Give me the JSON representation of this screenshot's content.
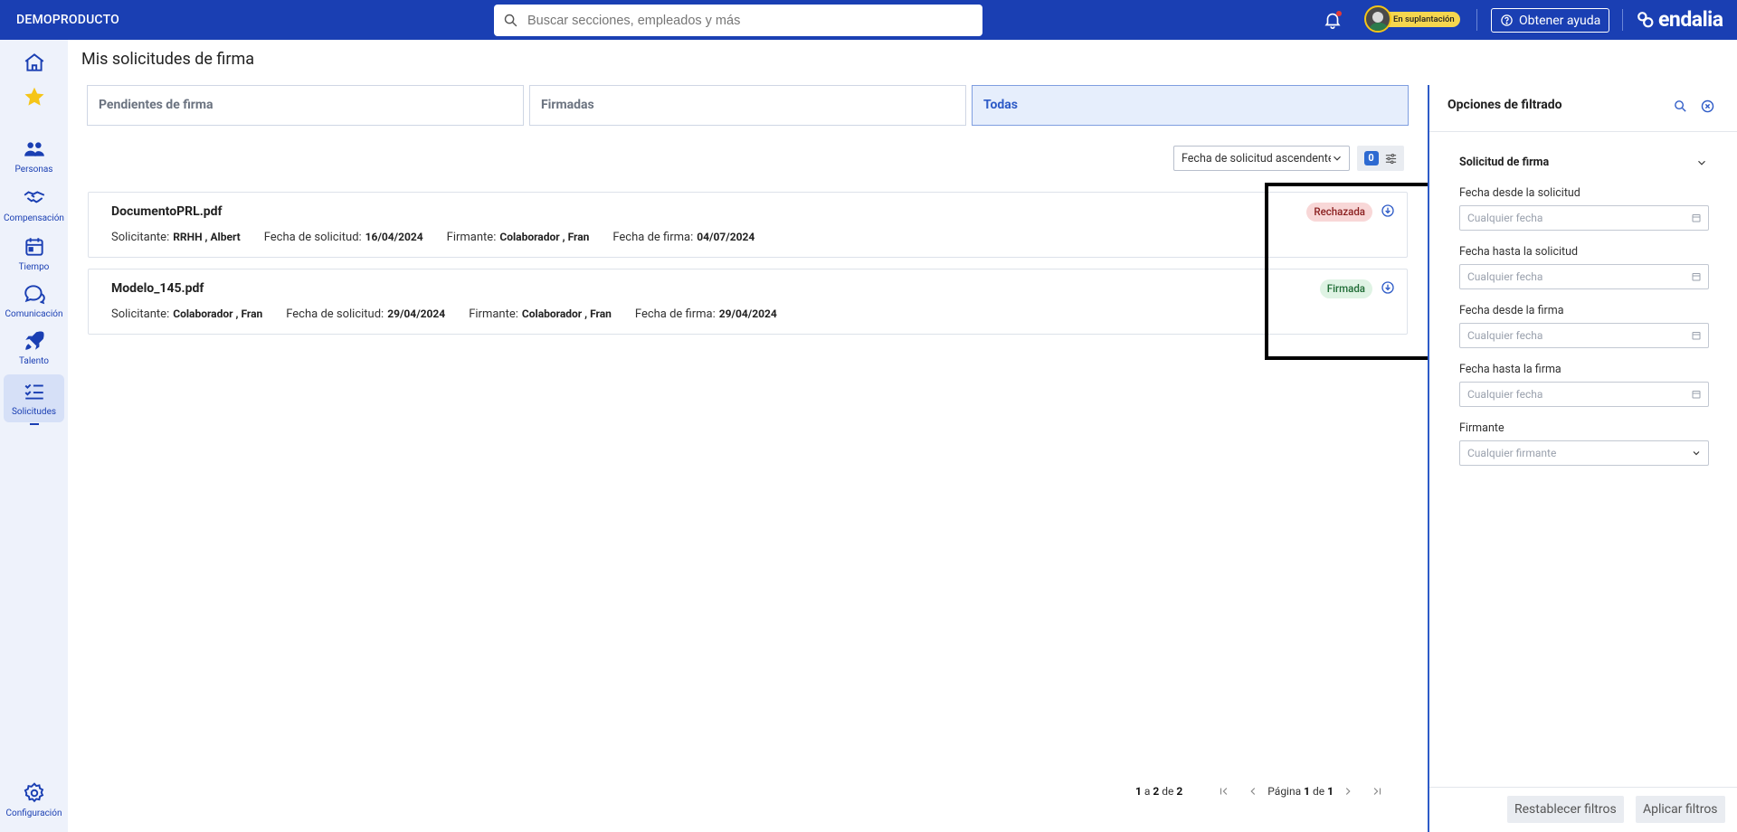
{
  "topbar": {
    "brand": "DEMOPRODUCTO",
    "search_placeholder": "Buscar secciones, empleados y más",
    "impersonation_label": "En suplantación",
    "help_label": "Obtener ayuda",
    "logo_text": "endalia"
  },
  "sidenav": {
    "items": [
      {
        "label": "",
        "icon": "home-icon"
      },
      {
        "label": "",
        "icon": "star-icon"
      },
      {
        "label": "Personas",
        "icon": "people-icon"
      },
      {
        "label": "Compensación",
        "icon": "handshake-icon"
      },
      {
        "label": "Tiempo",
        "icon": "calendar-icon"
      },
      {
        "label": "Comunicación",
        "icon": "chat-icon"
      },
      {
        "label": "Talento",
        "icon": "rocket-icon"
      },
      {
        "label": "Solicitudes",
        "icon": "checklist-icon"
      },
      {
        "label": "Configuración",
        "icon": "gear-icon"
      }
    ]
  },
  "main": {
    "title": "Mis solicitudes de firma",
    "tabs": [
      "Pendientes de firma",
      "Firmadas",
      "Todas"
    ],
    "sort_value": "Fecha de solicitud ascendente",
    "filter_count": "0",
    "labels": {
      "solicitante": "Solicitante:",
      "fecha_solicitud": "Fecha de solicitud:",
      "firmante": "Firmante:",
      "fecha_firma": "Fecha de firma:"
    },
    "requests": [
      {
        "file": "DocumentoPRL.pdf",
        "solicitante": "RRHH , Albert",
        "fecha_solicitud": "16/04/2024",
        "firmante": "Colaborador , Fran",
        "fecha_firma": "04/07/2024",
        "status": "Rechazada"
      },
      {
        "file": "Modelo_145.pdf",
        "solicitante": "Colaborador , Fran",
        "fecha_solicitud": "29/04/2024",
        "firmante": "Colaborador , Fran",
        "fecha_firma": "29/04/2024",
        "status": "Firmada"
      }
    ],
    "pager": {
      "from": "1",
      "a": "a",
      "to": "2",
      "de": "de",
      "total": "2",
      "page_word": "Página",
      "page": "1",
      "of_word": "de",
      "pages": "1"
    }
  },
  "filters": {
    "title": "Opciones de filtrado",
    "section_title": "Solicitud de firma",
    "fields": [
      {
        "label": "Fecha desde la solicitud",
        "placeholder": "Cualquier fecha"
      },
      {
        "label": "Fecha hasta la solicitud",
        "placeholder": "Cualquier fecha"
      },
      {
        "label": "Fecha desde la firma",
        "placeholder": "Cualquier fecha"
      },
      {
        "label": "Fecha hasta la firma",
        "placeholder": "Cualquier fecha"
      }
    ],
    "firmante_label": "Firmante",
    "firmante_placeholder": "Cualquier firmante",
    "reset_label": "Restablecer filtros",
    "apply_label": "Aplicar filtros"
  },
  "colors": {
    "primary": "#1a3fb3",
    "rejected_bg": "#f8d7d7",
    "signed_bg": "#dff3e4"
  }
}
